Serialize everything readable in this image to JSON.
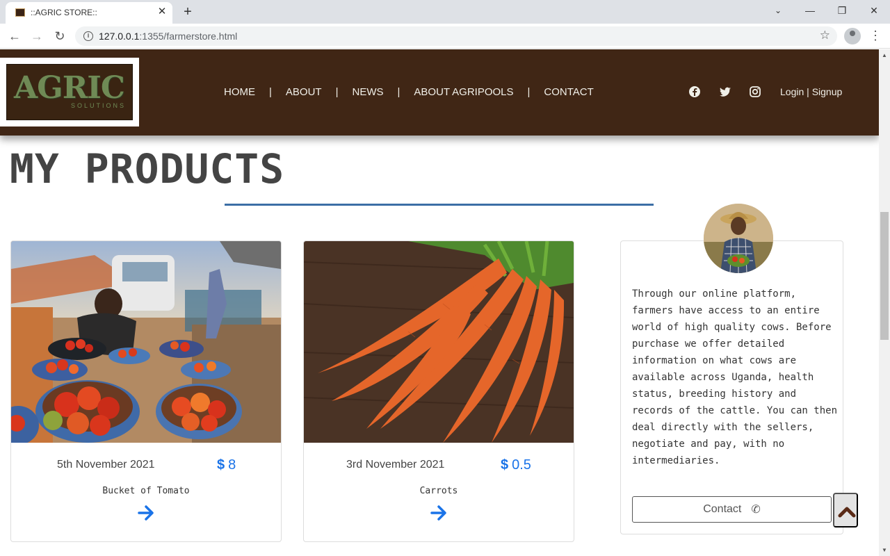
{
  "browser": {
    "tab_title": "::AGRIC STORE::",
    "tab_close": "✕",
    "new_tab": "+",
    "url_host": "127.0.0.1",
    "url_rest": ":1355/farmerstore.html",
    "minimize": "—",
    "restore": "❐",
    "close": "✕",
    "back": "←",
    "forward": "→",
    "reload": "↻"
  },
  "header": {
    "logo_text": "AGRIC",
    "logo_sub": "SOLUTIONS",
    "nav": [
      "HOME",
      "ABOUT",
      "NEWS",
      "ABOUT AGRIPOOLS",
      "CONTACT"
    ],
    "separator": "|",
    "login": "Login",
    "login_sep": "|",
    "signup": "Signup"
  },
  "main": {
    "title": "MY PRODUCTS",
    "products": [
      {
        "date": "5th November 2021",
        "currency": "$",
        "price": "8",
        "name": "Bucket of Tomato"
      },
      {
        "date": "3rd November 2021",
        "currency": "$",
        "price": "0.5",
        "name": "Carrots"
      }
    ]
  },
  "sidebar": {
    "text": "Through our online platform, farmers have access to an entire world of high quality cows. Before purchase we offer detailed information on what cows are available across Uganda, health status, breeding history and records of the cattle. You can then deal directly with the sellers, negotiate and pay, with no intermediaries.",
    "contact_label": "Contact",
    "phone_glyph": "✆"
  },
  "colors": {
    "header_bg": "#402615",
    "accent_blue": "#1a73e8",
    "rule": "#3c6ea6",
    "back_top_arrow": "#5a2a16"
  }
}
